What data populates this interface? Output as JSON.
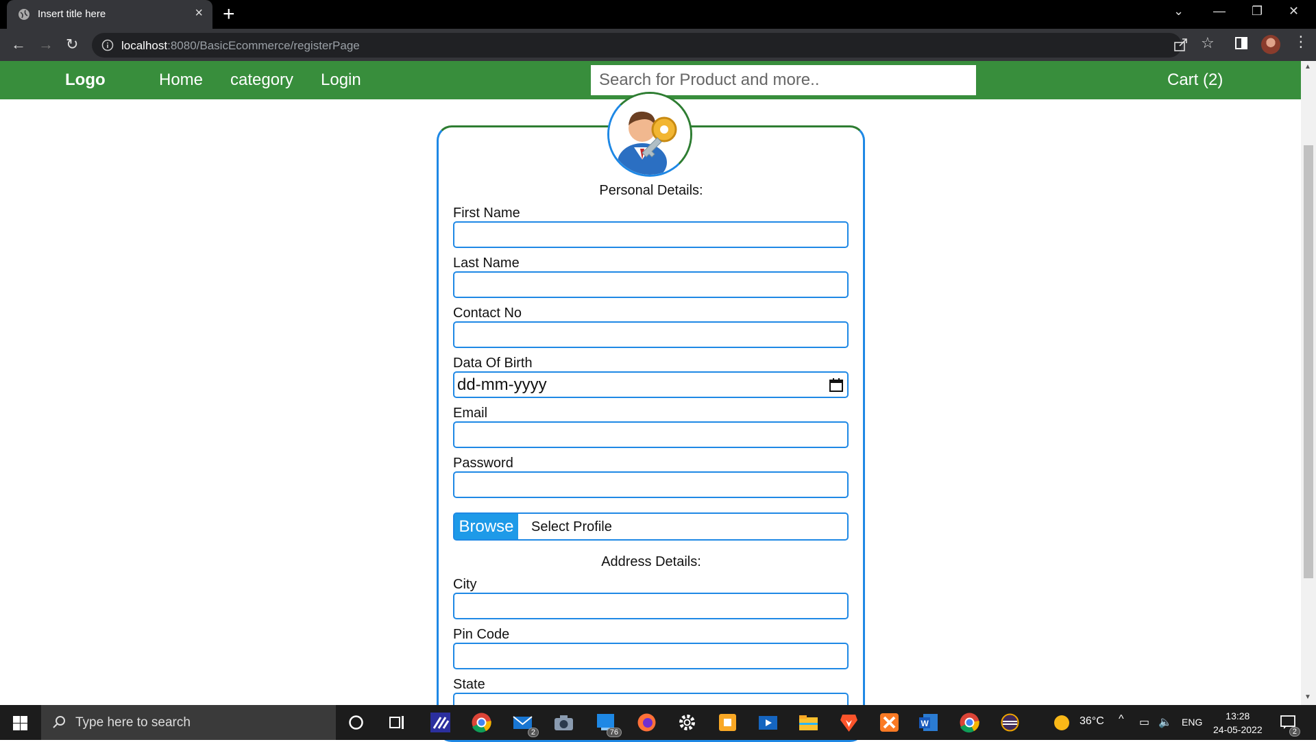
{
  "browser": {
    "tab_title": "Insert title here",
    "url_host": "localhost",
    "url_rest": ":8080/BasicEcommerce/registerPage"
  },
  "navbar": {
    "logo": "Logo",
    "home": "Home",
    "category": "category",
    "login": "Login",
    "search_placeholder": "Search for Product and more..",
    "cart": "Cart (2)",
    "bg_color": "#388e3c"
  },
  "form": {
    "personal_heading": "Personal Details:",
    "first_name_label": "First Name",
    "last_name_label": "Last Name",
    "contact_label": "Contact No",
    "dob_label": "Data Of Birth",
    "dob_placeholder": "dd-mm-yyyy",
    "email_label": "Email",
    "password_label": "Password",
    "browse_button": "Browse",
    "profile_label": "Select Profile",
    "address_heading": "Address Details:",
    "city_label": "City",
    "pin_label": "Pin Code",
    "state_label": "State"
  },
  "taskbar": {
    "search_placeholder": "Type here to search",
    "badges": {
      "mail": "2",
      "tasks": "76",
      "notifications": "2"
    },
    "weather": "36°C",
    "language": "ENG",
    "time": "13:28",
    "date": "24-05-2022"
  }
}
